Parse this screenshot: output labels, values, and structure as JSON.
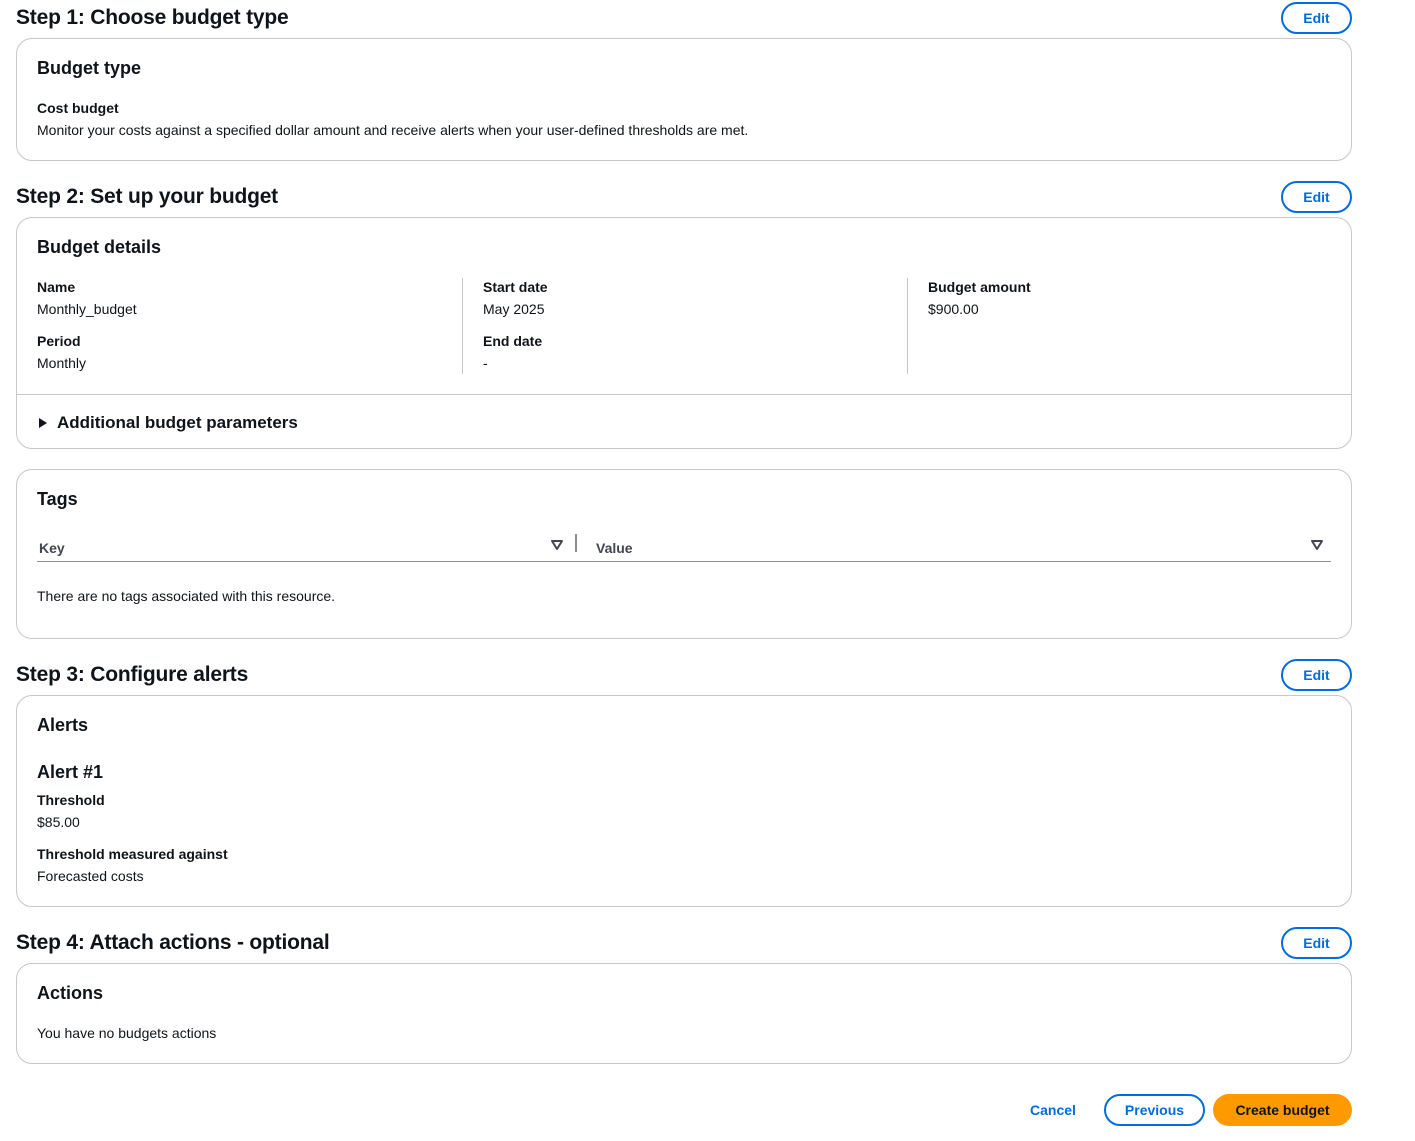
{
  "step1": {
    "title": "Step 1: Choose budget type",
    "edit_label": "Edit",
    "card_title": "Budget type",
    "type_label": "Cost budget",
    "type_description": "Monitor your costs against a specified dollar amount and receive alerts when your user-defined thresholds are met."
  },
  "step2": {
    "title": "Step 2: Set up your budget",
    "edit_label": "Edit",
    "card_title": "Budget details",
    "name_label": "Name",
    "name_value": "Monthly_budget",
    "period_label": "Period",
    "period_value": "Monthly",
    "start_date_label": "Start date",
    "start_date_value": "May 2025",
    "end_date_label": "End date",
    "end_date_value": "-",
    "amount_label": "Budget amount",
    "amount_value": "$900.00",
    "additional_params_label": "Additional budget parameters"
  },
  "tags": {
    "card_title": "Tags",
    "columns": [
      "Key",
      "Value"
    ],
    "empty_message": "There are no tags associated with this resource."
  },
  "step3": {
    "title": "Step 3: Configure alerts",
    "edit_label": "Edit",
    "card_title": "Alerts",
    "alert_title": "Alert #1",
    "threshold_label": "Threshold",
    "threshold_value": "$85.00",
    "measured_label": "Threshold measured against",
    "measured_value": "Forecasted costs"
  },
  "step4": {
    "title": "Step 4: Attach actions - optional",
    "edit_label": "Edit",
    "card_title": "Actions",
    "empty_message": "You have no budgets actions"
  },
  "footer": {
    "cancel_label": "Cancel",
    "previous_label": "Previous",
    "create_label": "Create budget"
  },
  "colors": {
    "link_blue": "#006ce0",
    "primary_orange": "#ff9900",
    "border_gray": "#c6c6cd",
    "text_dark": "#0f141a"
  },
  "icons": {
    "expand": "caret-right-icon",
    "sort": "sort-down-icon"
  }
}
